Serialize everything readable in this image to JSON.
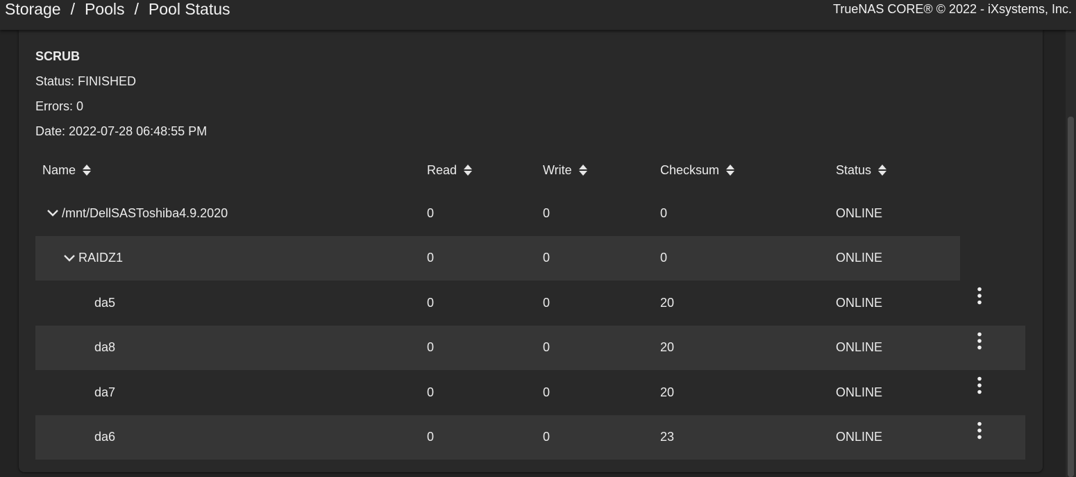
{
  "breadcrumb": [
    "Storage",
    "Pools",
    "Pool Status"
  ],
  "breadcrumb_sep": "/",
  "copyright": "TrueNAS CORE® © 2022 - iXsystems, Inc.",
  "scrub": {
    "title": "SCRUB",
    "status": "Status: FINISHED",
    "errors": "Errors: 0",
    "date": "Date: 2022-07-28 06:48:55 PM"
  },
  "table": {
    "headers": [
      "Name",
      "Read",
      "Write",
      "Checksum",
      "Status"
    ],
    "rows": [
      {
        "name": "/mnt/DellSASToshiba4.9.2020",
        "read": "0",
        "write": "0",
        "checksum": "0",
        "status": "ONLINE"
      },
      {
        "name": "RAIDZ1",
        "read": "0",
        "write": "0",
        "checksum": "0",
        "status": "ONLINE"
      },
      {
        "name": "da5",
        "read": "0",
        "write": "0",
        "checksum": "20",
        "status": "ONLINE"
      },
      {
        "name": "da8",
        "read": "0",
        "write": "0",
        "checksum": "20",
        "status": "ONLINE"
      },
      {
        "name": "da7",
        "read": "0",
        "write": "0",
        "checksum": "20",
        "status": "ONLINE"
      },
      {
        "name": "da6",
        "read": "0",
        "write": "0",
        "checksum": "23",
        "status": "ONLINE"
      }
    ]
  },
  "icons": {
    "sort": "sort-updown-icon",
    "expand": "chevron-down-icon",
    "menu": "more-vertical-icon"
  },
  "colors": {
    "background": "#232323",
    "card": "#292929",
    "shaded_row": "#363636",
    "text": "#ececec"
  }
}
